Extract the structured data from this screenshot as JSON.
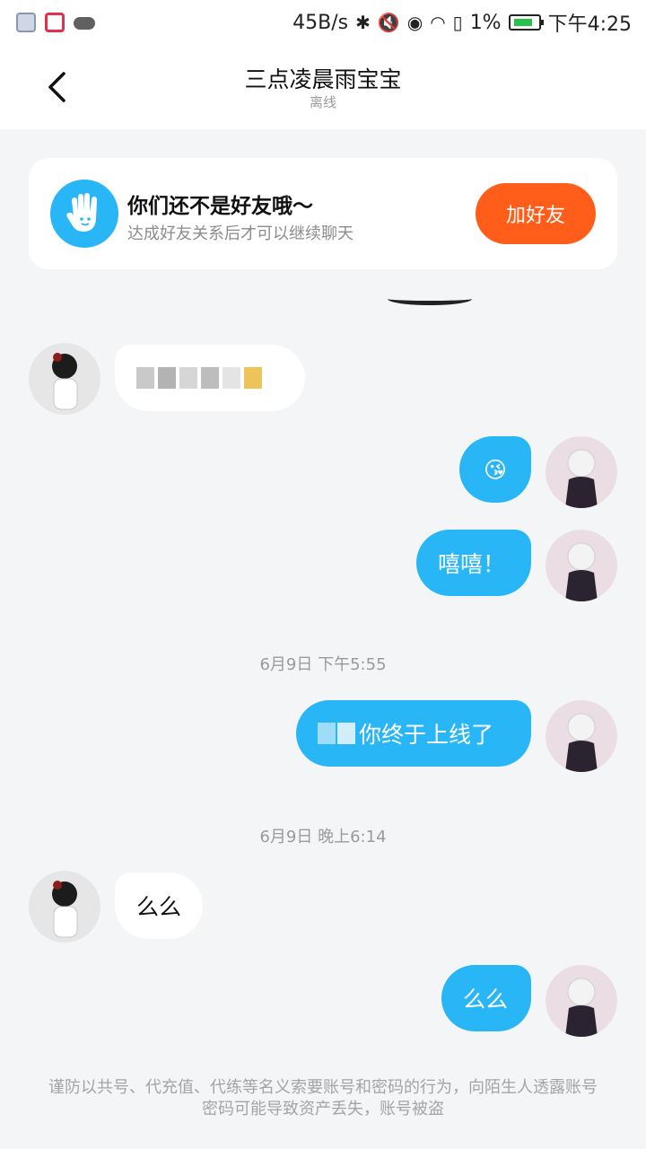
{
  "status_bar": {
    "net_speed": "45B/s",
    "battery_percent": "1%",
    "time": "下午4:25",
    "icons": [
      "gallery-app-icon",
      "video-app-icon",
      "cloud-icon",
      "bluetooth-icon",
      "mute-icon",
      "eye-icon",
      "wifi-icon",
      "sim-alert-icon",
      "battery-charging-icon"
    ]
  },
  "header": {
    "title": "三点凌晨雨宝宝",
    "subtitle": "离线",
    "back_icon": "chevron-left-icon"
  },
  "friend_card": {
    "title": "你们还不是好友哦～",
    "subtitle": "达成好友关系后才可以继续聊天",
    "button": "加好友",
    "icon": "waving-hand-icon"
  },
  "messages": [
    {
      "sender": "them",
      "text": "",
      "blurred": true
    },
    {
      "sender": "me",
      "text": "😘"
    },
    {
      "sender": "me",
      "text": "嘻嘻！"
    },
    {
      "sender": "me",
      "text": "你终于上线了",
      "blurred_prefix": true
    },
    {
      "sender": "them",
      "text": "么么"
    },
    {
      "sender": "me",
      "text": "么么"
    }
  ],
  "timestamps": [
    "6月9日 下午5:55",
    "6月9日 晚上6:14"
  ],
  "footer_notice": "谨防以共号、代充值、代练等名义索要账号和密码的行为，向陌生人透露账号密码可能导致资产丢失，账号被盗",
  "colors": {
    "bubble_me": "#29b6f6",
    "bubble_them": "#ffffff",
    "add_button": "#ff5e1a",
    "background": "#f4f5f7"
  }
}
